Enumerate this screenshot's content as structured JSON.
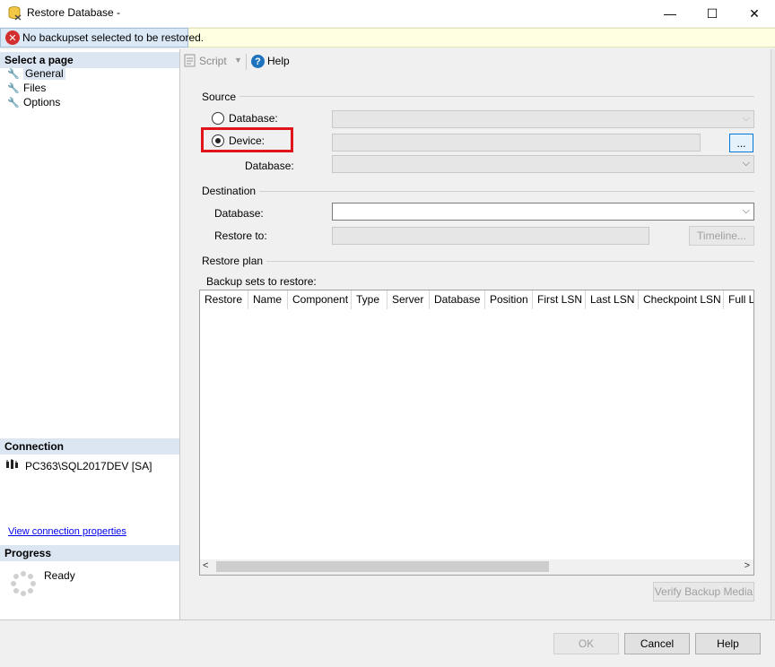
{
  "window": {
    "title": "Restore Database -",
    "minimize": "—",
    "maximize": "☐",
    "close": "✕"
  },
  "error": {
    "icon": "error-icon",
    "message": "No backupset selected to be restored."
  },
  "left_panel": {
    "select_page_header": "Select a page",
    "pages": [
      {
        "label": "General",
        "icon": "wrench-icon",
        "selected": true
      },
      {
        "label": "Files",
        "icon": "wrench-icon",
        "selected": false
      },
      {
        "label": "Options",
        "icon": "wrench-icon",
        "selected": false
      }
    ],
    "connection_header": "Connection",
    "connection_name": "PC363\\SQL2017DEV [SA]",
    "connection_link": "View connection properties",
    "progress_header": "Progress",
    "progress_status": "Ready"
  },
  "toolbar": {
    "script_label": "Script",
    "help_label": "Help"
  },
  "source": {
    "title": "Source",
    "database_radio": "Database:",
    "device_radio": "Device:",
    "device_database_label": "Database:",
    "browse_label": "...",
    "selected": "device"
  },
  "destination": {
    "title": "Destination",
    "database_label": "Database:",
    "database_value": "",
    "restore_to_label": "Restore to:",
    "timeline_label": "Timeline..."
  },
  "restore_plan": {
    "title": "Restore plan",
    "backup_sets_label": "Backup sets to restore:",
    "columns": [
      "Restore",
      "Name",
      "Component",
      "Type",
      "Server",
      "Database",
      "Position",
      "First LSN",
      "Last LSN",
      "Checkpoint LSN",
      "Full LS"
    ],
    "verify_label": "Verify Backup Media"
  },
  "footer": {
    "ok_label": "OK",
    "cancel_label": "Cancel",
    "help_label": "Help"
  },
  "colors": {
    "highlight": "#e0151b",
    "selected_page": "#dbe6f2",
    "error_bar": "#ffffe1",
    "link": "#0000ee"
  }
}
